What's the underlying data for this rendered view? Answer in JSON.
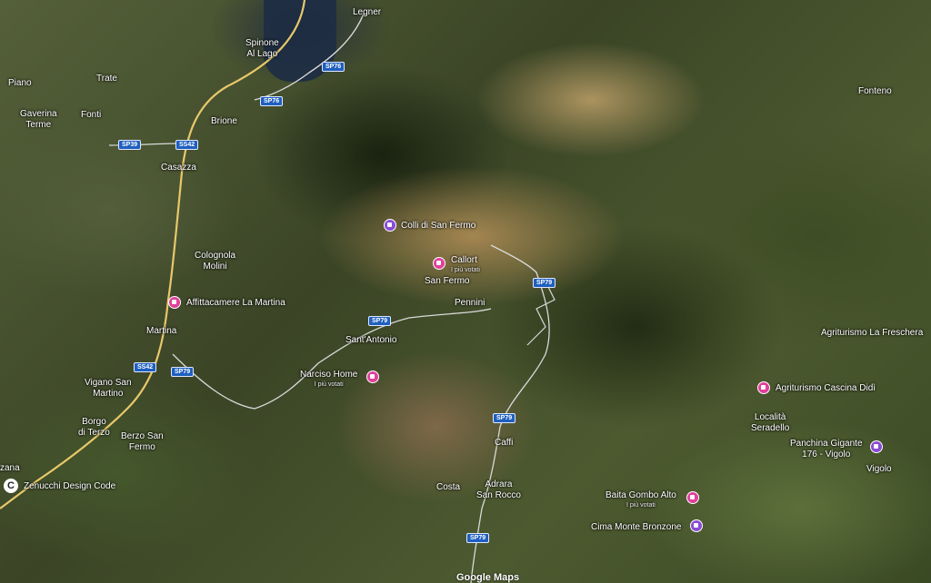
{
  "colors": {
    "poi_pink": "#e0409a",
    "poi_purple": "#8a4bd6",
    "road_yellow": "#e8c86a",
    "shield_blue": "#1f5fbf"
  },
  "places": {
    "legner": "Legner",
    "spinone": "Spinone\nAl Lago",
    "piano": "Piano",
    "trate": "Trate",
    "gaverina": "Gaverina\nTerme",
    "fonti": "Fonti",
    "brione": "Brione",
    "casazza": "Casazza",
    "colognola": "Colognola\nMolini",
    "martina": "Martina",
    "vigano": "Vigano San\nMartino",
    "borgo": "Borgo\ndi Terzo",
    "berzo": "Berzo San\nFermo",
    "zana": "zana",
    "san_fermo": "San Fermo",
    "pennini": "Pennini",
    "sant_antonio": "Sant'Antonio",
    "caffi": "Caffi",
    "costa": "Costa",
    "adrara": "Adrara\nSan Rocco",
    "fonteno": "Fonteno",
    "localita": "Località\nSeradello",
    "vigolo": "Vigolo",
    "watermark": "Google Maps"
  },
  "pois": {
    "colli": {
      "name": "Colli di San Fermo"
    },
    "callort": {
      "name": "Callort",
      "tag": "I più votati"
    },
    "affittacamere": {
      "name": "Affittacamere La Martina"
    },
    "narciso": {
      "name": "Narciso Home",
      "tag": "I più votati"
    },
    "agriturismo_freschera": {
      "name": "Agriturismo La Freschera"
    },
    "cascina": {
      "name": "Agriturismo Cascina Didì"
    },
    "panchina": {
      "name": "Panchina Gigante\n176 - Vigolo"
    },
    "baita": {
      "name": "Baita Gombo Alto",
      "tag": "I più votati"
    },
    "cima": {
      "name": "Cima Monte Bronzone"
    },
    "zenucchi": {
      "name": "Zenucchi Design Code"
    }
  },
  "roads": {
    "sp76a": "SP76",
    "sp76b": "SP76",
    "sp39": "SP39",
    "s542a": "SS42",
    "s542b": "SS42",
    "sp79a": "SP79",
    "sp79b": "SP79",
    "sp79c": "SP79",
    "sp79d": "SP79",
    "sp79e": "SP79"
  }
}
